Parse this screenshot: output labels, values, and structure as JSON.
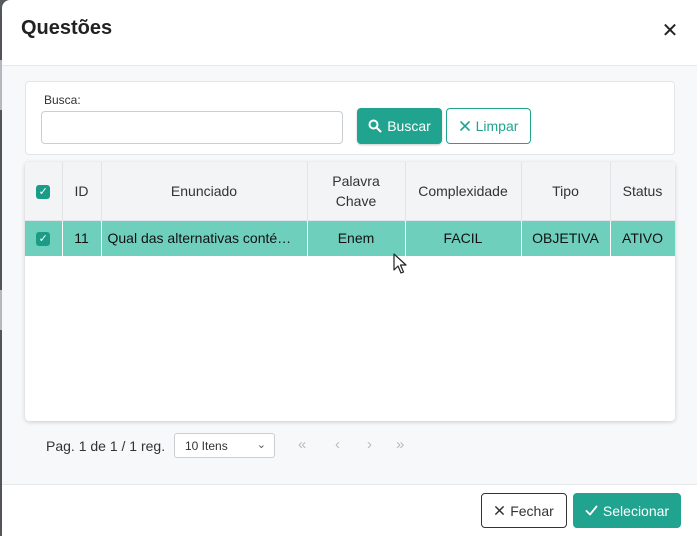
{
  "modal": {
    "title": "Questões",
    "close_icon": "close-icon"
  },
  "search": {
    "label": "Busca:",
    "value": "",
    "buscar_label": "Buscar",
    "limpar_label": "Limpar"
  },
  "table": {
    "columns": [
      "ID",
      "Enunciado",
      "Palavra Chave",
      "Complexidade",
      "Tipo",
      "Status"
    ],
    "rows": [
      {
        "selected": true,
        "id": "11",
        "enunciado": "Qual das alternativas conté…",
        "palavra_chave": "Enem",
        "complexidade": "FACIL",
        "tipo": "OBJETIVA",
        "status": "ATIVO"
      }
    ]
  },
  "pagination": {
    "text": "Pag. 1 de 1 / 1 reg.",
    "page_size": "10 Itens",
    "first": "«",
    "prev": "‹",
    "next": "›",
    "last": "»"
  },
  "footer": {
    "fechar_label": "Fechar",
    "selecionar_label": "Selecionar"
  },
  "colors": {
    "accent": "#20a48f",
    "row_selected": "#6fcfbd"
  }
}
